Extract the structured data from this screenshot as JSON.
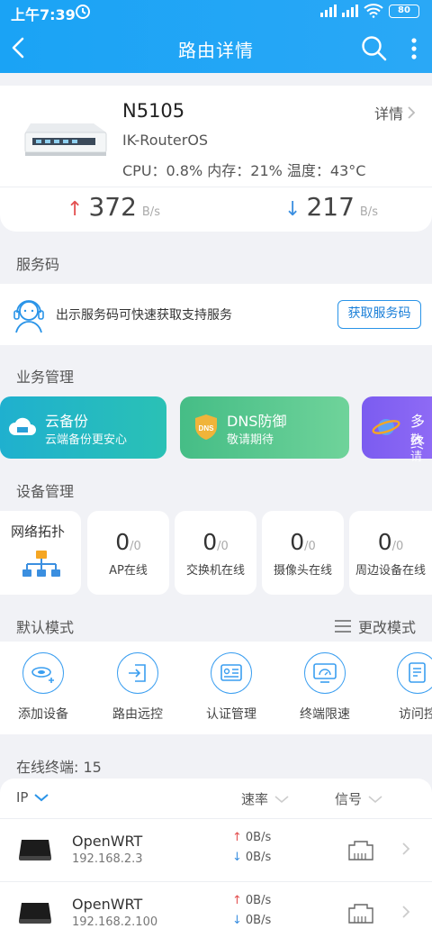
{
  "status": {
    "time": "上午7:39",
    "battery": "80"
  },
  "header": {
    "title": "路由详情"
  },
  "router": {
    "model": "N5105",
    "os": "IK-RouterOS",
    "stats": "CPU：0.8%  内存：21%  温度：43°C",
    "detail_label": "详情",
    "upload": {
      "value": "372",
      "unit": "B/s"
    },
    "download": {
      "value": "217",
      "unit": "B/s"
    }
  },
  "sections": {
    "service_code": "服务码",
    "business": "业务管理",
    "devices": "设备管理",
    "default_mode": "默认模式",
    "online": "在线终端: 15"
  },
  "service": {
    "text": "出示服务码可快速获取支持服务",
    "button": "获取服务码"
  },
  "business_tiles": [
    {
      "title": "云备份",
      "subtitle": "云端备份更安心"
    },
    {
      "title": "DNS防御",
      "subtitle": "敬请期待"
    },
    {
      "title": "多终",
      "subtitle": "敬请"
    }
  ],
  "devices": {
    "topology": "网络拓扑",
    "items": [
      {
        "count": "0",
        "total": "/0",
        "label": "AP在线"
      },
      {
        "count": "0",
        "total": "/0",
        "label": "交换机在线"
      },
      {
        "count": "0",
        "total": "/0",
        "label": "摄像头在线"
      },
      {
        "count": "0",
        "total": "/0",
        "label": "周边设备在线"
      }
    ]
  },
  "mode": {
    "change_label": "更改模式",
    "items": [
      {
        "label": "添加设备"
      },
      {
        "label": "路由远控"
      },
      {
        "label": "认证管理"
      },
      {
        "label": "终端限速"
      },
      {
        "label": "访问控"
      }
    ]
  },
  "terminals": {
    "columns": {
      "ip": "IP",
      "rate": "速率",
      "signal": "信号"
    },
    "rows": [
      {
        "name": "OpenWRT",
        "ip": "192.168.2.3",
        "up": "0B/s",
        "down": "0B/s"
      },
      {
        "name": "OpenWRT",
        "ip": "192.168.2.100",
        "up": "0B/s",
        "down": "0B/s"
      }
    ]
  },
  "colors": {
    "header": "#1aa3f5",
    "tile_backup": "#22b5c8",
    "tile_dns": "#5cc98a",
    "tile_multi": "#7b5cf0",
    "accent": "#2a94e8"
  }
}
